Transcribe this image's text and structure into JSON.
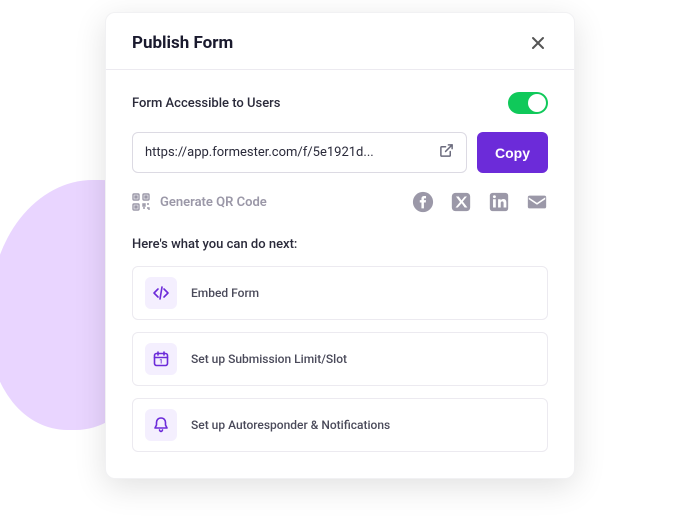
{
  "modal": {
    "title": "Publish Form",
    "accessible_label": "Form Accessible to Users",
    "url": "https://app.formester.com/f/5e1921d...",
    "copy_label": "Copy",
    "qr_label": "Generate QR Code",
    "next_heading": "Here's what you can do next:",
    "actions": [
      {
        "label": "Embed Form"
      },
      {
        "label": "Set up Submission Limit/Slot"
      },
      {
        "label": "Set up Autoresponder & Notifications"
      }
    ]
  }
}
